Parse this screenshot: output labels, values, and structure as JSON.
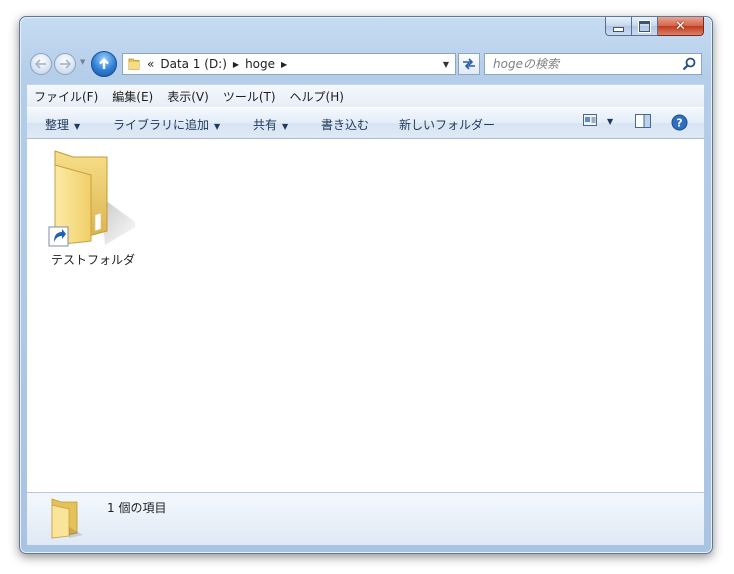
{
  "window": {
    "caption_buttons": {
      "minimize": "minimize",
      "maximize": "maximize",
      "close": "✕"
    }
  },
  "nav": {
    "address": {
      "overflow_chevron": "«",
      "segments": [
        "Data 1 (D:)",
        "hoge"
      ]
    },
    "search_placeholder": "hogeの検索"
  },
  "menubar": {
    "items": [
      "ファイル(F)",
      "編集(E)",
      "表示(V)",
      "ツール(T)",
      "ヘルプ(H)"
    ]
  },
  "commandbar": {
    "organize": "整理",
    "add_to_library": "ライブラリに追加",
    "share": "共有",
    "burn": "書き込む",
    "new_folder": "新しいフォルダー"
  },
  "content": {
    "items": [
      {
        "name": "テストフォルダ",
        "icon": "folder-shortcut-icon"
      }
    ]
  },
  "details": {
    "count_text": "1 個の項目"
  },
  "colors": {
    "frame": "#b4cde9",
    "folder_yellow": "#f3d46e",
    "up_button": "#2d7fd6",
    "close_red": "#c1391b"
  }
}
